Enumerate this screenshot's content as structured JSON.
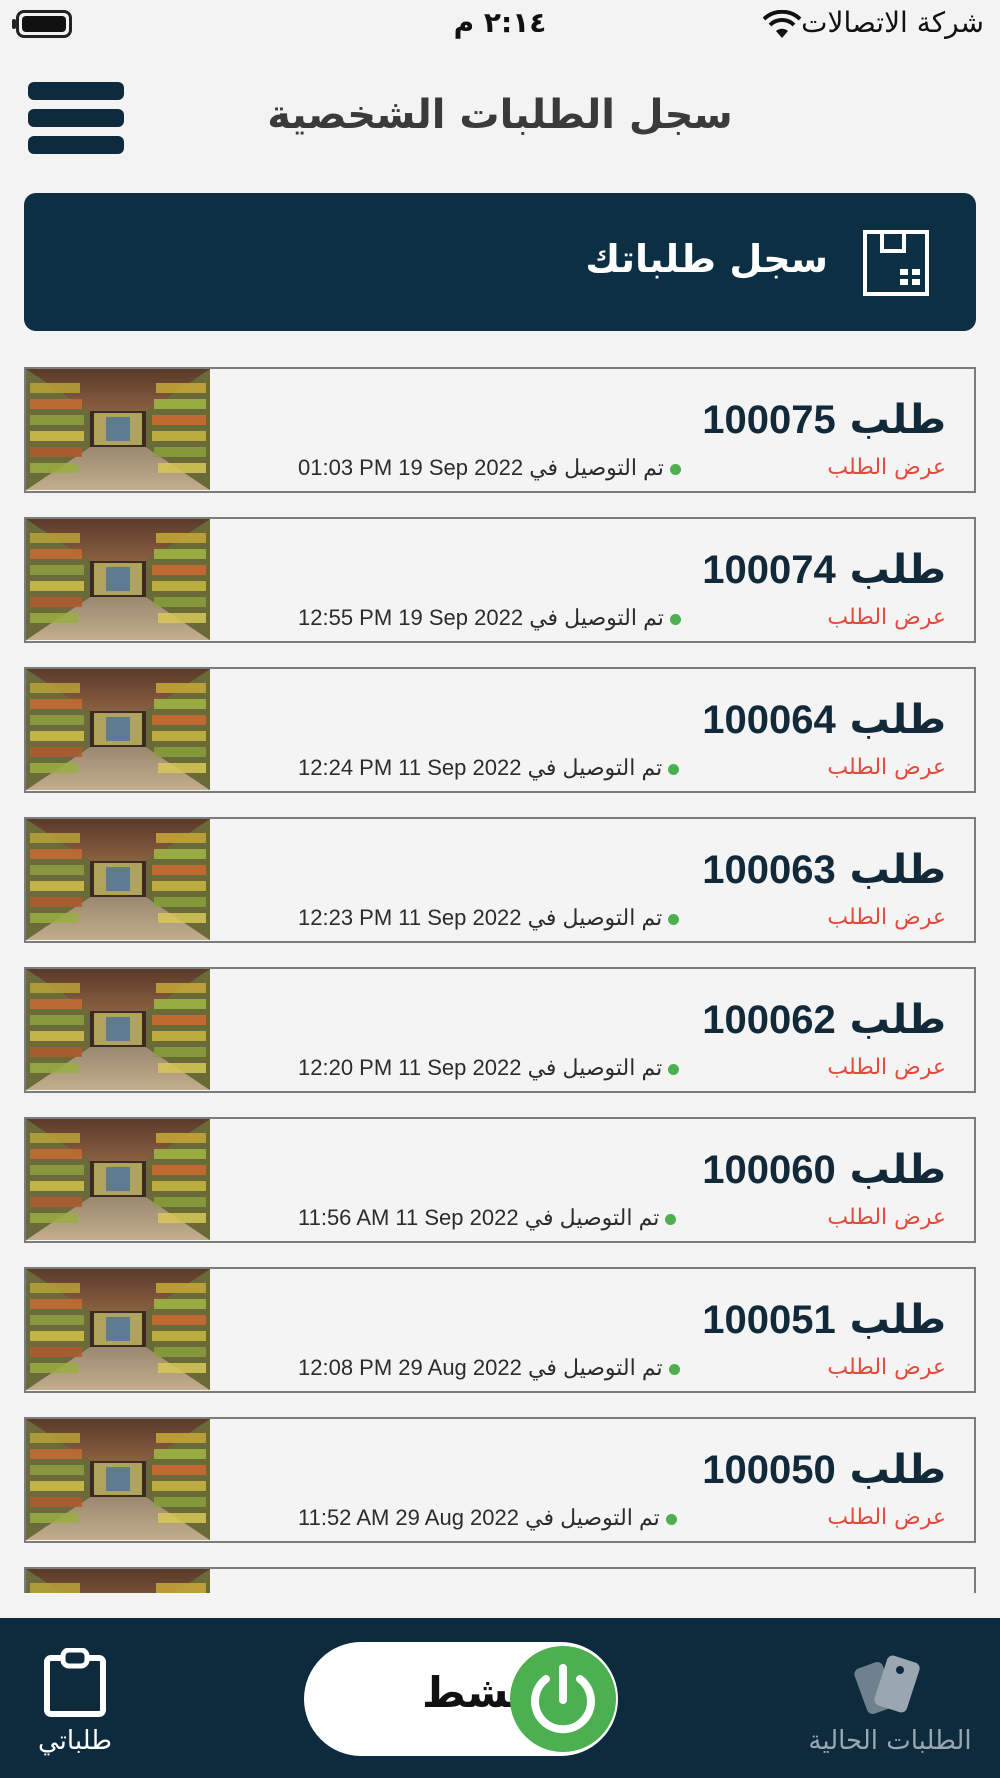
{
  "status_bar": {
    "carrier": "شركة الاتصالات",
    "time": "٢:١٤ م"
  },
  "header": {
    "title": "سجل الطلبات الشخصية",
    "menu_icon": "hamburger-menu-icon"
  },
  "banner": {
    "text": "سجل طلباتك",
    "icon": "order-box-icon"
  },
  "orders": [
    {
      "prefix": "طلب",
      "number": "100075",
      "view_label": "عرض الطلب",
      "status_text": "تم التوصيل في",
      "date_time": "01:03 PM 19 Sep 2022"
    },
    {
      "prefix": "طلب",
      "number": "100074",
      "view_label": "عرض الطلب",
      "status_text": "تم التوصيل في",
      "date_time": "12:55 PM 19 Sep 2022"
    },
    {
      "prefix": "طلب",
      "number": "100064",
      "view_label": "عرض الطلب",
      "status_text": "تم التوصيل في",
      "date_time": "12:24 PM 11 Sep 2022"
    },
    {
      "prefix": "طلب",
      "number": "100063",
      "view_label": "عرض الطلب",
      "status_text": "تم التوصيل في",
      "date_time": "12:23 PM 11 Sep 2022"
    },
    {
      "prefix": "طلب",
      "number": "100062",
      "view_label": "عرض الطلب",
      "status_text": "تم التوصيل في",
      "date_time": "12:20 PM 11 Sep 2022"
    },
    {
      "prefix": "طلب",
      "number": "100060",
      "view_label": "عرض الطلب",
      "status_text": "تم التوصيل في",
      "date_time": "11:56 AM 11 Sep 2022"
    },
    {
      "prefix": "طلب",
      "number": "100051",
      "view_label": "عرض الطلب",
      "status_text": "تم التوصيل في",
      "date_time": "12:08 PM 29 Aug 2022"
    },
    {
      "prefix": "طلب",
      "number": "100050",
      "view_label": "عرض الطلب",
      "status_text": "تم التوصيل في",
      "date_time": "11:52 AM 29 Aug 2022"
    },
    {
      "prefix": "",
      "number": "",
      "view_label": "",
      "status_text": "",
      "date_time": ""
    }
  ],
  "bottom_nav": {
    "my_orders_label": "طلباتي",
    "my_orders_icon": "clipboard-icon",
    "current_orders_label": "الطلبات الحالية",
    "current_orders_icon": "cards-icon",
    "status_toggle_label": "نشط",
    "status_toggle_icon": "power-icon"
  },
  "colors": {
    "primary": "#0d2b3c",
    "accent_green": "#4caf50",
    "link_red": "#e14b3e",
    "background": "#f3f3f3"
  }
}
